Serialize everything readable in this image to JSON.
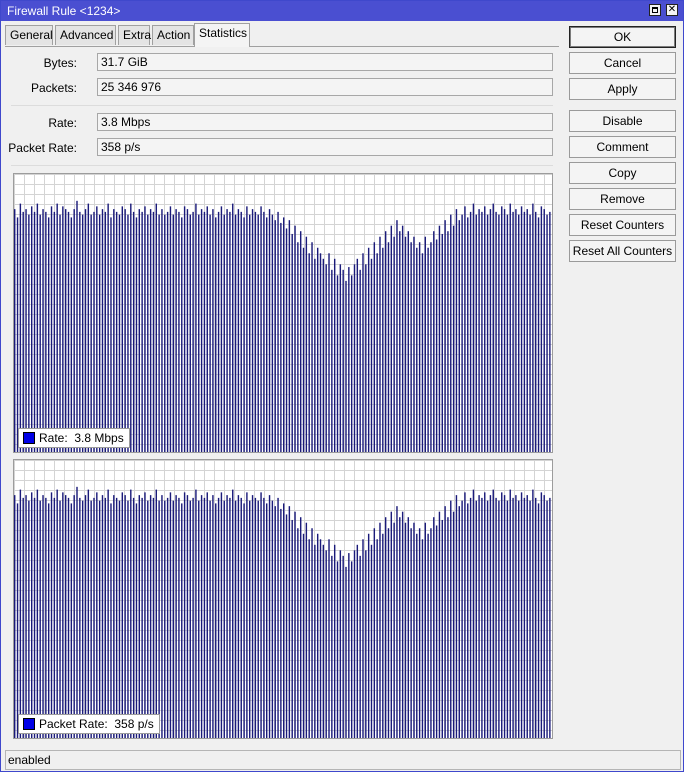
{
  "window": {
    "title": "Firewall Rule <1234>"
  },
  "tabs": [
    {
      "label": "General"
    },
    {
      "label": "Advanced"
    },
    {
      "label": "Extra"
    },
    {
      "label": "Action"
    },
    {
      "label": "Statistics",
      "active": true
    }
  ],
  "stats": {
    "bytes_label": "Bytes:",
    "bytes_value": "31.7 GiB",
    "packets_label": "Packets:",
    "packets_value": "25 346 976",
    "rate_label": "Rate:",
    "rate_value": "3.8 Mbps",
    "packet_rate_label": "Packet Rate:",
    "packet_rate_value": "358 p/s"
  },
  "buttons": {
    "ok": "OK",
    "cancel": "Cancel",
    "apply": "Apply",
    "disable": "Disable",
    "comment": "Comment",
    "copy": "Copy",
    "remove": "Remove",
    "reset_counters": "Reset Counters",
    "reset_all_counters": "Reset All Counters"
  },
  "status": {
    "text": "enabled"
  },
  "colors": {
    "bar": "#1a1a7a",
    "grid": "#d4d4d4",
    "legend_swatch": "#0000e6"
  },
  "chart_data": [
    {
      "type": "bar",
      "legend_label": "Rate:",
      "legend_value": "3.8 Mbps",
      "grid": true,
      "legend_position": "bottom-left",
      "ylim": [
        0,
        1
      ],
      "values": [
        0.88,
        0.85,
        0.9,
        0.87,
        0.88,
        0.86,
        0.89,
        0.87,
        0.9,
        0.86,
        0.88,
        0.87,
        0.85,
        0.89,
        0.87,
        0.9,
        0.86,
        0.89,
        0.88,
        0.87,
        0.85,
        0.88,
        0.91,
        0.87,
        0.86,
        0.88,
        0.9,
        0.86,
        0.87,
        0.89,
        0.86,
        0.88,
        0.87,
        0.9,
        0.85,
        0.88,
        0.87,
        0.86,
        0.89,
        0.88,
        0.86,
        0.9,
        0.87,
        0.85,
        0.88,
        0.87,
        0.89,
        0.86,
        0.88,
        0.87,
        0.9,
        0.86,
        0.88,
        0.86,
        0.87,
        0.89,
        0.86,
        0.88,
        0.87,
        0.85,
        0.89,
        0.88,
        0.86,
        0.87,
        0.9,
        0.86,
        0.88,
        0.87,
        0.89,
        0.86,
        0.88,
        0.85,
        0.87,
        0.89,
        0.86,
        0.88,
        0.87,
        0.9,
        0.86,
        0.88,
        0.87,
        0.85,
        0.89,
        0.86,
        0.88,
        0.87,
        0.86,
        0.89,
        0.87,
        0.85,
        0.88,
        0.86,
        0.84,
        0.87,
        0.83,
        0.85,
        0.81,
        0.84,
        0.79,
        0.82,
        0.76,
        0.8,
        0.74,
        0.78,
        0.72,
        0.76,
        0.7,
        0.74,
        0.72,
        0.7,
        0.68,
        0.72,
        0.66,
        0.7,
        0.64,
        0.68,
        0.66,
        0.62,
        0.67,
        0.64,
        0.68,
        0.7,
        0.66,
        0.72,
        0.68,
        0.74,
        0.7,
        0.76,
        0.72,
        0.78,
        0.74,
        0.8,
        0.76,
        0.82,
        0.78,
        0.84,
        0.8,
        0.82,
        0.78,
        0.8,
        0.76,
        0.78,
        0.74,
        0.76,
        0.72,
        0.78,
        0.74,
        0.76,
        0.8,
        0.77,
        0.82,
        0.79,
        0.84,
        0.8,
        0.86,
        0.82,
        0.88,
        0.84,
        0.86,
        0.89,
        0.85,
        0.87,
        0.9,
        0.86,
        0.88,
        0.87,
        0.89,
        0.86,
        0.88,
        0.9,
        0.87,
        0.86,
        0.89,
        0.88,
        0.86,
        0.9,
        0.87,
        0.88,
        0.86,
        0.89,
        0.87,
        0.88,
        0.86,
        0.9,
        0.87,
        0.85,
        0.89,
        0.88,
        0.86,
        0.87
      ]
    },
    {
      "type": "bar",
      "legend_label": "Packet Rate:",
      "legend_value": "358 p/s",
      "grid": true,
      "legend_position": "bottom-left",
      "ylim": [
        0,
        1
      ],
      "values": [
        0.88,
        0.85,
        0.9,
        0.87,
        0.88,
        0.86,
        0.89,
        0.87,
        0.9,
        0.86,
        0.88,
        0.87,
        0.85,
        0.89,
        0.87,
        0.9,
        0.86,
        0.89,
        0.88,
        0.87,
        0.85,
        0.88,
        0.91,
        0.87,
        0.86,
        0.88,
        0.9,
        0.86,
        0.87,
        0.89,
        0.86,
        0.88,
        0.87,
        0.9,
        0.85,
        0.88,
        0.87,
        0.86,
        0.89,
        0.88,
        0.86,
        0.9,
        0.87,
        0.85,
        0.88,
        0.87,
        0.89,
        0.86,
        0.88,
        0.87,
        0.9,
        0.86,
        0.88,
        0.86,
        0.87,
        0.89,
        0.86,
        0.88,
        0.87,
        0.85,
        0.89,
        0.88,
        0.86,
        0.87,
        0.9,
        0.86,
        0.88,
        0.87,
        0.89,
        0.86,
        0.88,
        0.85,
        0.87,
        0.89,
        0.86,
        0.88,
        0.87,
        0.9,
        0.86,
        0.88,
        0.87,
        0.85,
        0.89,
        0.86,
        0.88,
        0.87,
        0.86,
        0.89,
        0.87,
        0.85,
        0.88,
        0.86,
        0.84,
        0.87,
        0.83,
        0.85,
        0.81,
        0.84,
        0.79,
        0.82,
        0.76,
        0.8,
        0.74,
        0.78,
        0.72,
        0.76,
        0.7,
        0.74,
        0.72,
        0.7,
        0.68,
        0.72,
        0.66,
        0.7,
        0.64,
        0.68,
        0.66,
        0.62,
        0.67,
        0.64,
        0.68,
        0.7,
        0.66,
        0.72,
        0.68,
        0.74,
        0.7,
        0.76,
        0.72,
        0.78,
        0.74,
        0.8,
        0.76,
        0.82,
        0.78,
        0.84,
        0.8,
        0.82,
        0.78,
        0.8,
        0.76,
        0.78,
        0.74,
        0.76,
        0.72,
        0.78,
        0.74,
        0.76,
        0.8,
        0.77,
        0.82,
        0.79,
        0.84,
        0.8,
        0.86,
        0.82,
        0.88,
        0.84,
        0.86,
        0.89,
        0.85,
        0.87,
        0.9,
        0.86,
        0.88,
        0.87,
        0.89,
        0.86,
        0.88,
        0.9,
        0.87,
        0.86,
        0.89,
        0.88,
        0.86,
        0.9,
        0.87,
        0.88,
        0.86,
        0.89,
        0.87,
        0.88,
        0.86,
        0.9,
        0.87,
        0.85,
        0.89,
        0.88,
        0.86,
        0.87
      ]
    }
  ]
}
